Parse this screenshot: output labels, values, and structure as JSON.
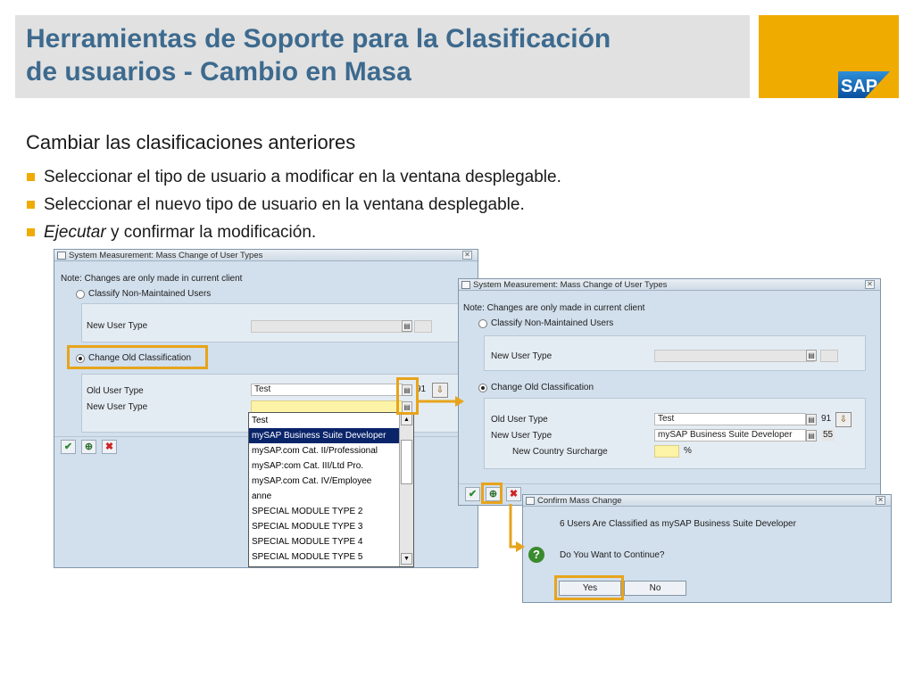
{
  "header": {
    "title_line1": "Herramientas de Soporte para la Clasificación",
    "title_line2": "de usuarios - Cambio en Masa",
    "logo_text": "SAP",
    "brand_color": "#f0ab00",
    "title_color": "#3d6a8e"
  },
  "intro": {
    "heading": "Cambiar las clasificaciones anteriores",
    "bullets": [
      "Seleccionar el tipo de usuario a modificar en la ventana desplegable.",
      "Seleccionar el nuevo tipo de usuario en la ventana desplegable."
    ],
    "bullet3_italic": "Ejecutar",
    "bullet3_rest": " y confirmar la modificación."
  },
  "win1": {
    "title": "System Measurement: Mass Change of User Types",
    "note": "Note: Changes are only made in current client",
    "radio_non_maintained": "Classify Non-Maintained Users",
    "label_new_user_type_top": "New User Type",
    "radio_change_old": "Change Old Classification",
    "label_old_user_type": "Old User Type",
    "old_user_type_value": "Test",
    "old_user_type_count": "91",
    "label_new_user_type": "New User Type",
    "dropdown_options": [
      "Test",
      "mySAP Business Suite Developer",
      "mySAP.com Cat. II/Professional",
      "mySAP:com Cat. III/Ltd Pro.",
      "mySAP.com Cat. IV/Employee",
      "anne",
      "SPECIAL MODULE TYPE 2",
      "SPECIAL MODULE TYPE 3",
      "SPECIAL MODULE TYPE 4",
      "SPECIAL MODULE TYPE 5"
    ],
    "dropdown_selected_index": 1
  },
  "win2": {
    "title": "System Measurement: Mass Change of User Types",
    "note": "Note: Changes are only made in current client",
    "radio_non_maintained": "Classify Non-Maintained Users",
    "label_new_user_type_top": "New User Type",
    "radio_change_old": "Change Old Classification",
    "label_old_user_type": "Old User Type",
    "old_user_type_value": "Test",
    "old_user_type_count": "91",
    "label_new_user_type": "New User Type",
    "new_user_type_value": "mySAP Business Suite Developer",
    "new_user_type_count": "55",
    "label_surcharge": "New Country Surcharge",
    "surcharge_unit": "%"
  },
  "confirm": {
    "title": "Confirm Mass Change",
    "message": "6 Users Are Classified as mySAP Business Suite Developer",
    "question": "Do You Want to Continue?",
    "yes_label": "Yes",
    "no_label": "No"
  },
  "icons": {
    "ok": "✔",
    "execute": "⊕",
    "cancel": "✖",
    "close": "✕",
    "f4_help": "▤",
    "picker": "⇩",
    "question": "?",
    "scroll_up": "▲",
    "scroll_down": "▼"
  },
  "highlight_color": "#e7a41b"
}
